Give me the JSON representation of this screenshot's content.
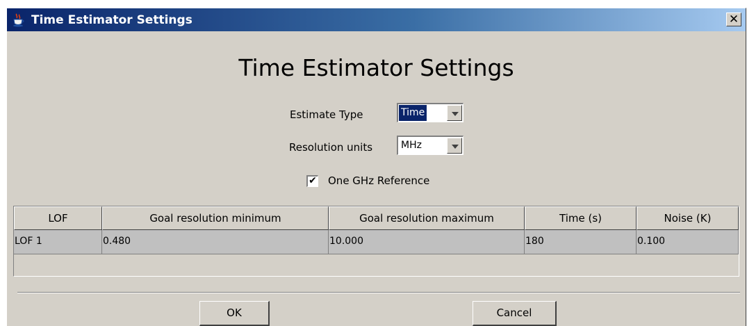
{
  "window": {
    "title": "Time Estimator Settings",
    "close_label": "✕"
  },
  "dialog": {
    "heading": "Time Estimator Settings",
    "estimate_type": {
      "label": "Estimate Type",
      "value": "Time"
    },
    "resolution_units": {
      "label": "Resolution units",
      "value": "MHz"
    },
    "one_ghz_reference": {
      "label": "One GHz Reference",
      "checked": true,
      "mark": "✔"
    }
  },
  "table": {
    "columns": [
      "LOF",
      "Goal resolution minimum",
      "Goal resolution maximum",
      "Time (s)",
      "Noise (K)"
    ],
    "rows": [
      [
        "LOF 1",
        "0.480",
        "10.000",
        "180",
        "0.100"
      ]
    ]
  },
  "buttons": {
    "ok": "OK",
    "cancel": "Cancel"
  },
  "colors": {
    "titlebar_start": "#0a246a",
    "titlebar_end": "#a6caf0",
    "dialog_bg": "#d4d0c8",
    "selection": "#0a246a"
  }
}
